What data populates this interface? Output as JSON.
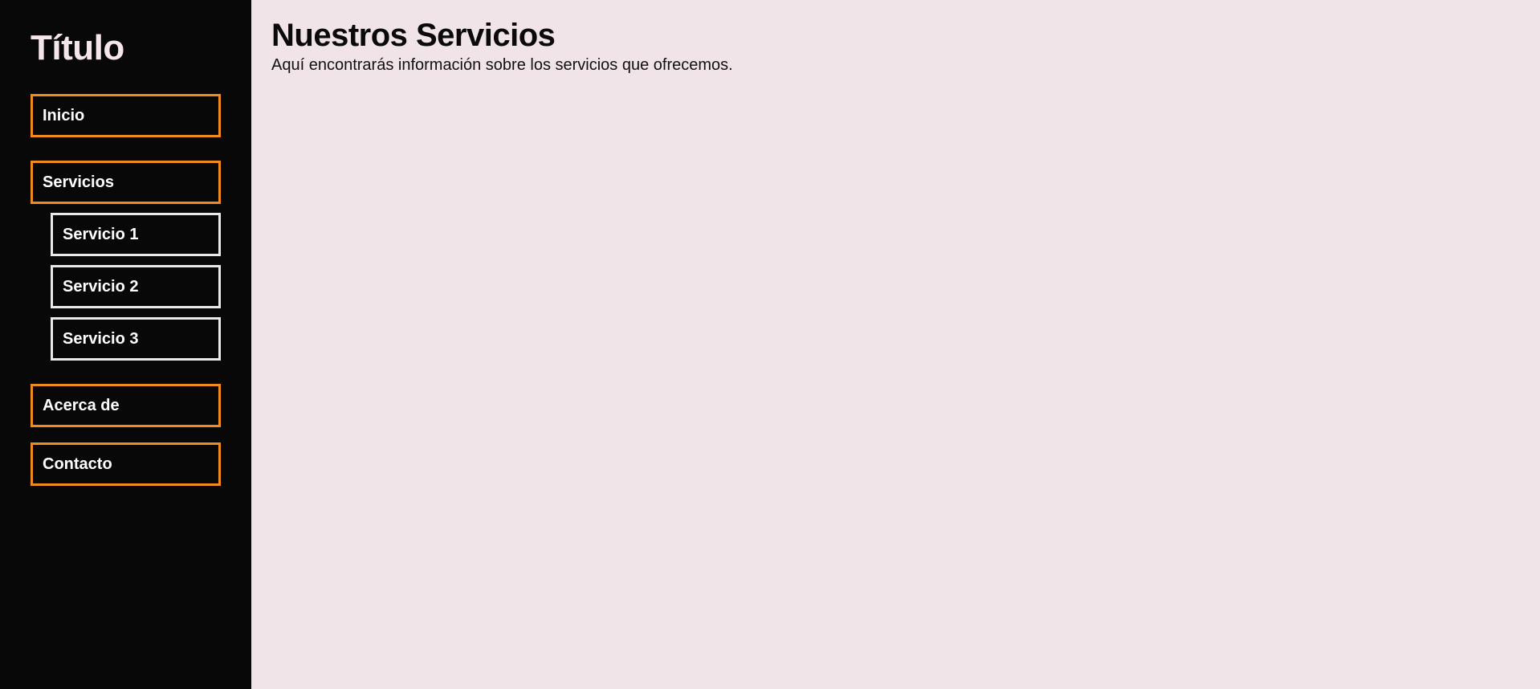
{
  "sidebar": {
    "title": "Título",
    "items": [
      {
        "label": "Inicio"
      },
      {
        "label": "Servicios"
      },
      {
        "label": "Acerca de"
      },
      {
        "label": "Contacto"
      }
    ],
    "subitems": [
      {
        "label": "Servicio 1"
      },
      {
        "label": "Servicio 2"
      },
      {
        "label": "Servicio 3"
      }
    ]
  },
  "main": {
    "title": "Nuestros Servicios",
    "description": "Aquí encontrarás información sobre los servicios que ofrecemos."
  },
  "colors": {
    "sidebar_bg": "#080808",
    "main_bg": "#f0e4e8",
    "nav_border": "#f08c1c",
    "subnav_border": "#e9e9e9"
  }
}
